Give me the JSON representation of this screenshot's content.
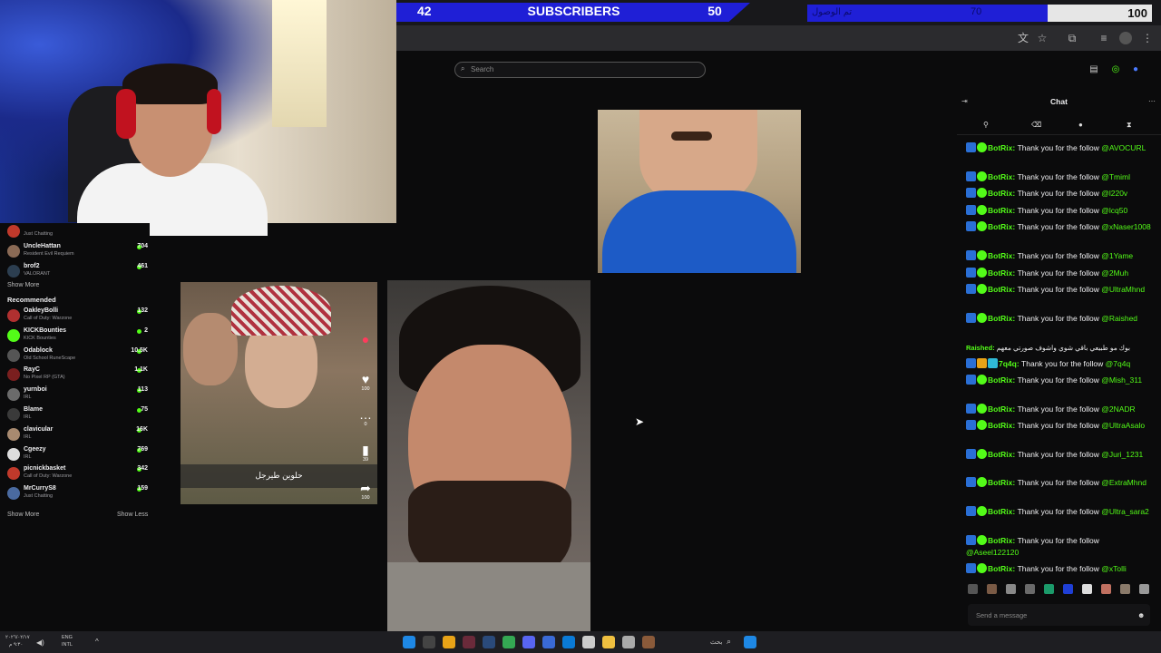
{
  "subscriber_bar": {
    "current": "42",
    "label": "SUBSCRIBERS",
    "goal": "50"
  },
  "second_bar": {
    "label": "تم الوصول",
    "mid": "70",
    "goal": "100"
  },
  "browser": {
    "icons": [
      "translate-icon",
      "star-icon",
      "extensions-icon",
      "menu-icon",
      "profile-icon",
      "more-icon"
    ]
  },
  "header": {
    "search_placeholder": "Search"
  },
  "sidebar": {
    "top_channels": [
      {
        "name": "",
        "game": "Just Chatting",
        "viewers": "",
        "color": "#c0392b"
      },
      {
        "name": "UncleHattan",
        "game": "Resident Evil Requiem",
        "viewers": "704",
        "color": "#8a6a55"
      },
      {
        "name": "brof2",
        "game": "VALORANT",
        "viewers": "461",
        "color": "#2c3e50"
      }
    ],
    "show_more_1": "Show More",
    "recommended_heading": "Recommended",
    "recommended": [
      {
        "name": "OakleyBolli",
        "game": "Call of Duty: Warzone",
        "viewers": "132",
        "color": "#b03030"
      },
      {
        "name": "KICKBounties",
        "game": "KICK Bounties",
        "viewers": "2",
        "color": "#53fc18"
      },
      {
        "name": "Odablock",
        "game": "Old School RuneScape",
        "viewers": "10.5K",
        "color": "#555555"
      },
      {
        "name": "RayC",
        "game": "No Pixel RP (GTA)",
        "viewers": "1.1K",
        "color": "#7a1f1f"
      },
      {
        "name": "yurnboi",
        "game": "IRL",
        "viewers": "113",
        "color": "#6b6b6b"
      },
      {
        "name": "Blame",
        "game": "IRL",
        "viewers": "75",
        "color": "#3a3a3a"
      },
      {
        "name": "clavicular",
        "game": "IRL",
        "viewers": "16K",
        "color": "#a88a70"
      },
      {
        "name": "Cgeezy",
        "game": "IRL",
        "viewers": "769",
        "color": "#dddddd"
      },
      {
        "name": "picnickbasket",
        "game": "Call of Duty: Warzone",
        "viewers": "342",
        "color": "#c0392b"
      },
      {
        "name": "MrCurryS8",
        "game": "Just Chatting",
        "viewers": "159",
        "color": "#4a6aa0"
      }
    ],
    "show_more_2": "Show More",
    "show_less": "Show Less"
  },
  "tiktok": {
    "caption": "حلوين طيرجل",
    "likes": "100",
    "comments": "0",
    "saves": "39",
    "shares": "100"
  },
  "chat": {
    "title": "Chat",
    "messages": [
      {
        "user": "BotRix",
        "text": "Thank you for the follow",
        "mention": "@AVOCURL"
      },
      {
        "user": "BotRix",
        "text": "Thank you for the follow",
        "mention": "@Tmiml"
      },
      {
        "user": "BotRix",
        "text": "Thank you for the follow",
        "mention": "@l220v"
      },
      {
        "user": "BotRix",
        "text": "Thank you for the follow",
        "mention": "@lcq50"
      },
      {
        "user": "BotRix",
        "text": "Thank you for the follow",
        "mention": "@xNaser1008"
      },
      {
        "user": "BotRix",
        "text": "Thank you for the follow",
        "mention": "@1Yame"
      },
      {
        "user": "BotRix",
        "text": "Thank you for the follow",
        "mention": "@2Muh"
      },
      {
        "user": "BotRix",
        "text": "Thank you for the follow",
        "mention": "@UltraMhnd"
      },
      {
        "user": "BotRix",
        "text": "Thank you for the follow",
        "mention": "@Raished"
      },
      {
        "user": "Raished",
        "text": "بوك مو طبيعي باقي شوي واشوف صورتي معهم",
        "mention": ""
      },
      {
        "user": "7q4q",
        "text": "Thank you for the follow",
        "mention": "@7q4q"
      },
      {
        "user": "BotRix",
        "text": "Thank you for the follow",
        "mention": "@Mish_311"
      },
      {
        "user": "BotRix",
        "text": "Thank you for the follow",
        "mention": "@2NADR"
      },
      {
        "user": "BotRix",
        "text": "Thank you for the follow",
        "mention": "@UltraAsalo"
      },
      {
        "user": "BotRix",
        "text": "Thank you for the follow",
        "mention": "@Juri_1231"
      },
      {
        "user": "BotRix",
        "text": "Thank you for the follow",
        "mention": "@ExtraMhnd"
      },
      {
        "user": "BotRix",
        "text": "Thank you for the follow",
        "mention": "@Ultra_sara2"
      },
      {
        "user": "BotRix",
        "text": "Thank you for the follow",
        "mention": "@Aseel122120"
      },
      {
        "user": "BotRix",
        "text": "Thank you for the follow",
        "mention": "@xTolli"
      }
    ],
    "input_placeholder": "Send a message"
  },
  "taskbar": {
    "date": "٢٠٢٦/٠٢/١٧",
    "time": "٩:٣٠ م",
    "lang": "ENG",
    "lang2": "INTL",
    "search_label": "بحث"
  }
}
